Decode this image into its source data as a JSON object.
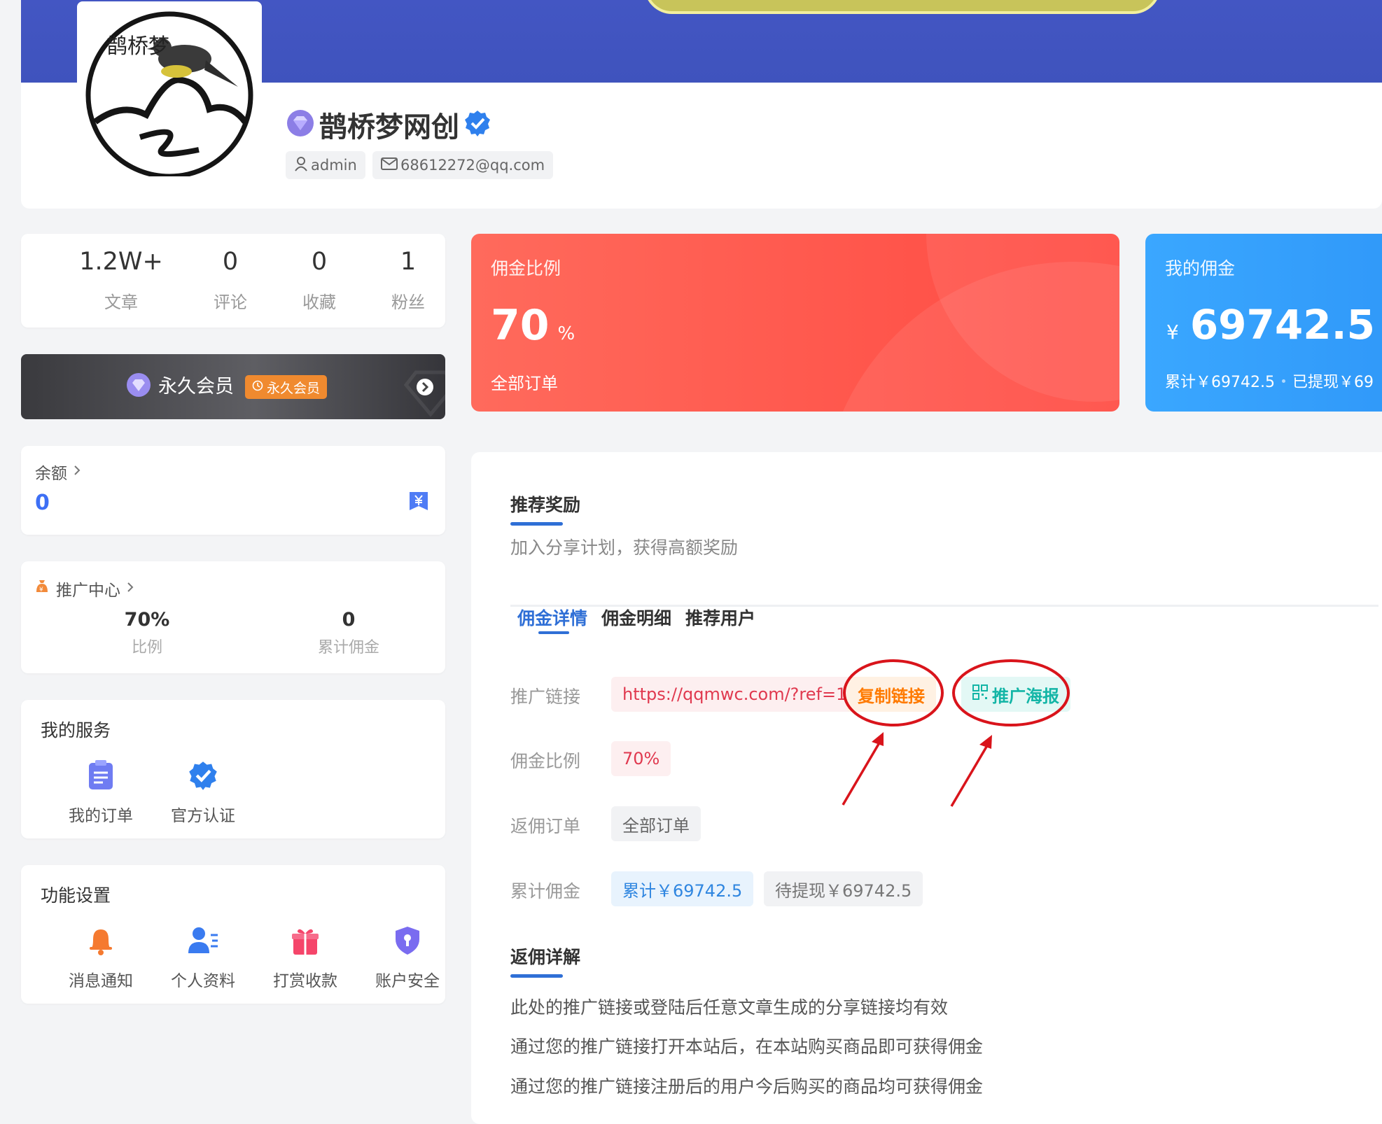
{
  "profile": {
    "name": "鹊桥梦网创",
    "username": "admin",
    "email": "68612272@qq.com",
    "avatar_text": "鹊桥梦"
  },
  "stats": [
    {
      "value": "1.2W+",
      "label": "文章"
    },
    {
      "value": "0",
      "label": "评论"
    },
    {
      "value": "0",
      "label": "收藏"
    },
    {
      "value": "1",
      "label": "粉丝"
    }
  ],
  "vip": {
    "label": "永久会员",
    "badge": "永久会员"
  },
  "balance": {
    "title": "余额",
    "value": "0"
  },
  "promo_center": {
    "title": "推广中心",
    "ratio_value": "70%",
    "ratio_label": "比例",
    "total_value": "0",
    "total_label": "累计佣金"
  },
  "services": {
    "title": "我的服务",
    "items": [
      {
        "label": "我的订单",
        "icon": "clipboard-icon"
      },
      {
        "label": "官方认证",
        "icon": "verified-icon"
      }
    ]
  },
  "settings": {
    "title": "功能设置",
    "items": [
      {
        "label": "消息通知",
        "icon": "bell-icon"
      },
      {
        "label": "个人资料",
        "icon": "user-card-icon"
      },
      {
        "label": "打赏收款",
        "icon": "gift-icon"
      },
      {
        "label": "账户安全",
        "icon": "shield-icon"
      }
    ]
  },
  "commission_rate_card": {
    "title": "佣金比例",
    "value": "70",
    "unit": "%",
    "sub": "全部订单"
  },
  "my_commission_card": {
    "title": "我的佣金",
    "currency": "¥",
    "value": "69742.5",
    "total": "累计￥69742.5",
    "withdrawn": "已提现￥69"
  },
  "referral": {
    "title": "推荐奖励",
    "subtitle": "加入分享计划，获得高额奖励",
    "tabs": [
      "佣金详情",
      "佣金明细",
      "推荐用户"
    ],
    "active_tab": 0,
    "link_label": "推广链接",
    "link": "https://qqmwc.com/?ref=1",
    "copy_button": "复制链接",
    "poster_button": "推广海报",
    "rate_label": "佣金比例",
    "rate_value": "70%",
    "orders_label": "返佣订单",
    "orders_value": "全部订单",
    "total_label": "累计佣金",
    "total_value": "累计￥69742.5",
    "pending_value": "待提现￥69742.5"
  },
  "rebate": {
    "title": "返佣详解",
    "lines": [
      "此处的推广链接或登陆后任意文章生成的分享链接均有效",
      "通过您的推广链接打开本站后，在本站购买商品即可获得佣金",
      "通过您的推广链接注册后的用户今后购买的商品均可获得佣金"
    ]
  },
  "colors": {
    "accent": "#2f6fd6",
    "red_card": "#ff5248",
    "blue_card": "#36a2ff",
    "vip_badge": "#f08a2f",
    "copy": "#ff7a00",
    "poster": "#13b5a6",
    "annotation": "#d9141b"
  }
}
